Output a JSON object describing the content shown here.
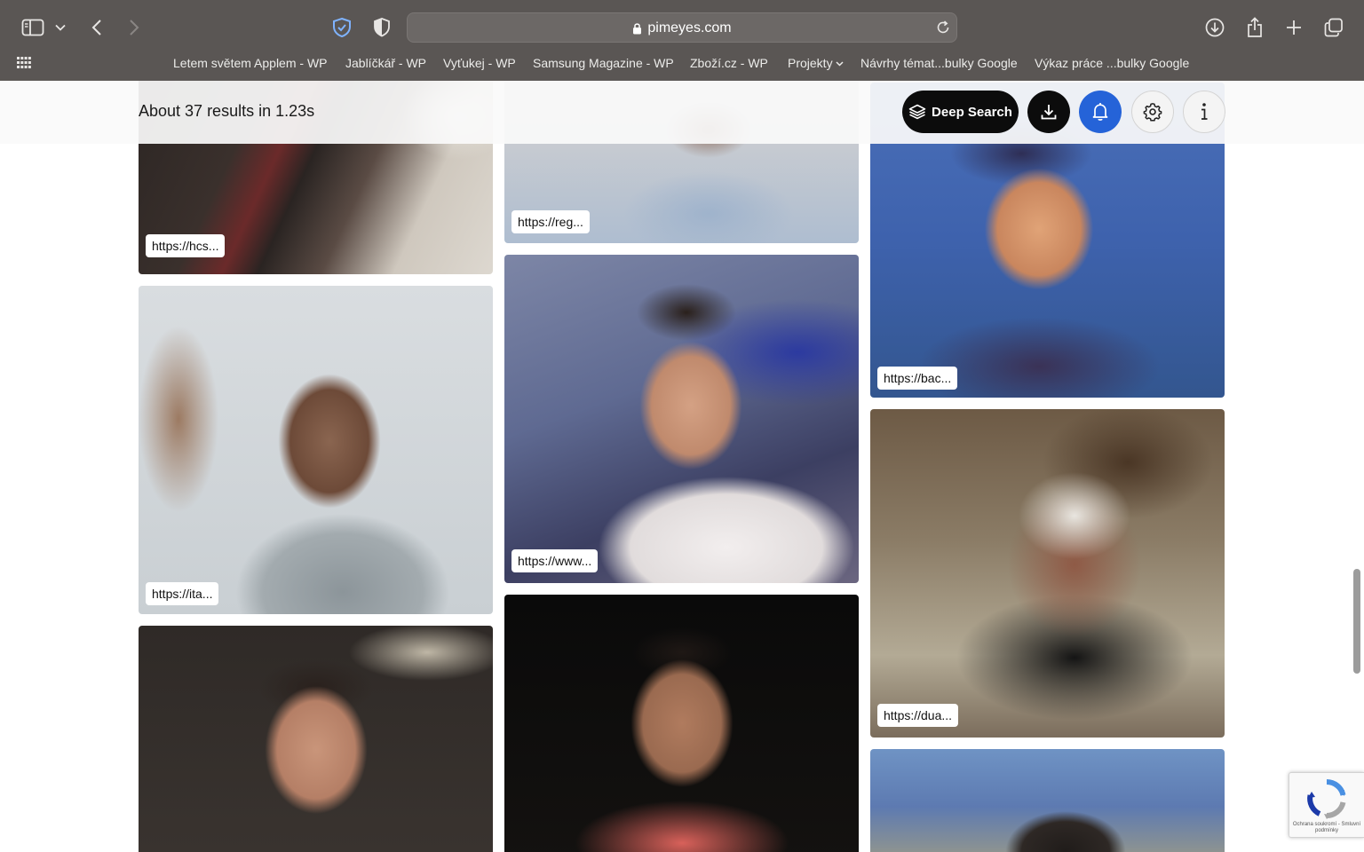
{
  "browser": {
    "url": "pimeyes.com",
    "bookmarks": [
      "Letem světem Applem - WP",
      "Jablíčkář - WP",
      "Vyťukej - WP",
      "Samsung Magazine - WP",
      "Zboží.cz - WP",
      "Projekty",
      "Návrhy témat...bulky Google",
      "Výkaz práce ...bulky Google"
    ]
  },
  "header": {
    "results_text": "About 37 results in 1.23s",
    "deep_search_label": "Deep Search"
  },
  "results": {
    "col1": [
      "https://hcs...",
      "https://ita..."
    ],
    "col2": [
      "https://reg...",
      "https://www..."
    ],
    "col3": [
      "https://bac...",
      "https://dua..."
    ]
  },
  "recaptcha": {
    "terms": "Ochrana soukromí - Smluvní podmínky"
  },
  "colors": {
    "chrome_bg": "#5a5654",
    "accent_blue": "#2563d8",
    "button_black": "#0c0c0c"
  }
}
